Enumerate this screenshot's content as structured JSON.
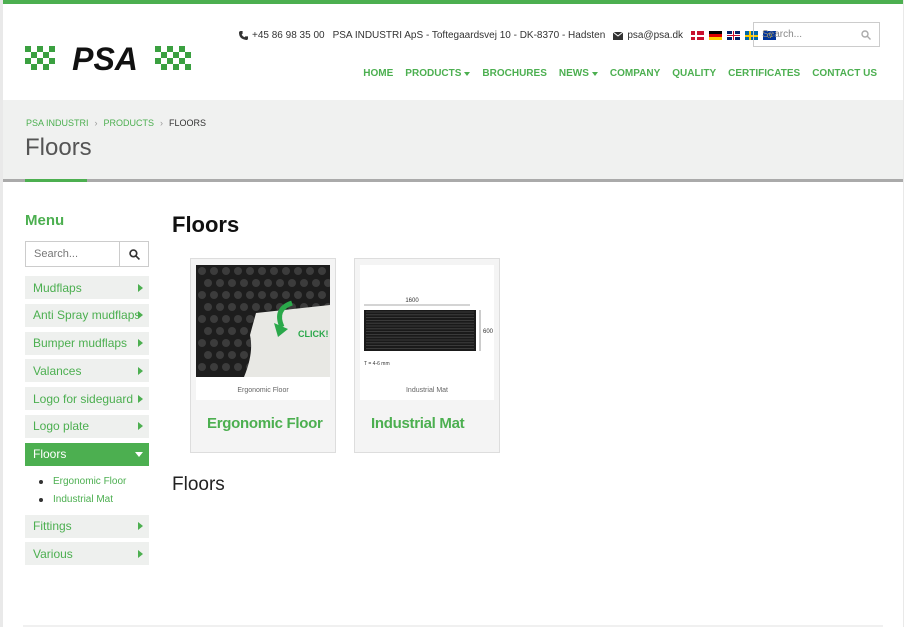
{
  "header": {
    "brand": "PSA",
    "phone": "+45 86 98 35 00",
    "address": "PSA INDUSTRI ApS - Toftegaardsvej 10 - DK-8370 - Hadsten",
    "email": "psa@psa.dk",
    "search_placeholder": "Search...",
    "nav": [
      {
        "label": "HOME",
        "dropdown": false
      },
      {
        "label": "PRODUCTS",
        "dropdown": true
      },
      {
        "label": "BROCHURES",
        "dropdown": false
      },
      {
        "label": "NEWS",
        "dropdown": true
      },
      {
        "label": "COMPANY",
        "dropdown": false
      },
      {
        "label": "QUALITY",
        "dropdown": false
      },
      {
        "label": "CERTIFICATES",
        "dropdown": false
      },
      {
        "label": "CONTACT US",
        "dropdown": false
      }
    ],
    "flags": [
      "flag-dk",
      "flag-de",
      "flag-uk",
      "flag-se",
      "flag-eu"
    ]
  },
  "breadcrumb": [
    "PSA INDUSTRI",
    "PRODUCTS",
    "FLOORS"
  ],
  "page_title": "Floors",
  "sidebar": {
    "title": "Menu",
    "search_placeholder": "Search...",
    "items": [
      {
        "label": "Mudflaps"
      },
      {
        "label": "Anti Spray mudflaps"
      },
      {
        "label": "Bumper mudflaps"
      },
      {
        "label": "Valances"
      },
      {
        "label": "Logo for sideguard"
      },
      {
        "label": "Logo plate"
      },
      {
        "label": "Floors",
        "active": true
      },
      {
        "label": "Fittings"
      },
      {
        "label": "Various"
      }
    ],
    "subitems": [
      "Ergonomic Floor",
      "Industrial Mat"
    ]
  },
  "main": {
    "title": "Floors",
    "products": [
      {
        "name": "Ergonomic Floor",
        "caption": "Ergonomic Floor",
        "badge": "CLICK!"
      },
      {
        "name": "Industrial Mat",
        "caption": "Industrial Mat",
        "dim_w": "1600",
        "dim_h": "600",
        "thickness": "T = 4-6 mm"
      }
    ],
    "subheading": "Floors"
  },
  "colors": {
    "accent": "#4caf50",
    "band": "#f0f1f0"
  }
}
